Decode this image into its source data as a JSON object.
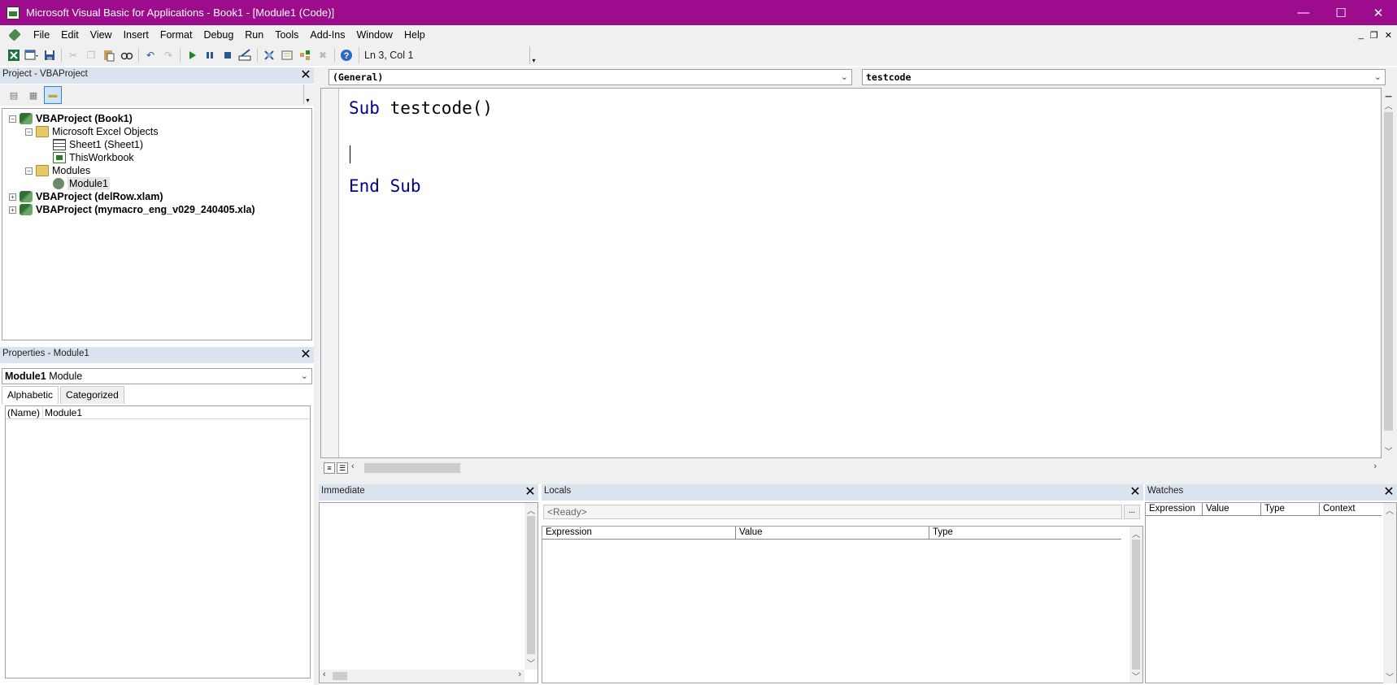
{
  "window": {
    "title": "Microsoft Visual Basic for Applications - Book1 - [Module1 (Code)]",
    "minimize": "—",
    "maximize": "☐",
    "close": "✕"
  },
  "menu": [
    "File",
    "Edit",
    "View",
    "Insert",
    "Format",
    "Debug",
    "Run",
    "Tools",
    "Add-Ins",
    "Window",
    "Help"
  ],
  "mdi": {
    "minimize": "_",
    "restore": "❐",
    "close": "✕"
  },
  "toolbar": {
    "status": "Ln 3, Col 1",
    "icons": [
      "excel-icon",
      "insert-userform-icon",
      "save-icon",
      "cut-icon",
      "copy-icon",
      "paste-icon",
      "find-icon",
      "undo-icon",
      "redo-icon",
      "run-icon",
      "break-icon",
      "reset-icon",
      "design-mode-icon",
      "project-explorer-icon",
      "properties-window-icon",
      "object-browser-icon",
      "toolbox-icon",
      "help-icon"
    ]
  },
  "project": {
    "title": "Project - VBAProject",
    "close": "✕",
    "nodes": [
      {
        "label": "VBAProject (Book1)",
        "bold": true
      },
      {
        "label": "Microsoft Excel Objects",
        "bold": false
      },
      {
        "label": "Sheet1 (Sheet1)",
        "bold": false
      },
      {
        "label": "ThisWorkbook",
        "bold": false
      },
      {
        "label": "Modules",
        "bold": false
      },
      {
        "label": "Module1",
        "bold": false
      },
      {
        "label": "VBAProject (delRow.xlam)",
        "bold": true
      },
      {
        "label": "VBAProject (mymacro_eng_v029_240405.xla)",
        "bold": true
      }
    ]
  },
  "properties": {
    "title": "Properties - Module1",
    "close": "✕",
    "object_name": "Module1",
    "object_type": "Module",
    "tabs": [
      "Alphabetic",
      "Categorized"
    ],
    "rows": [
      {
        "key": "(Name)",
        "value": "Module1"
      }
    ]
  },
  "code": {
    "object_combo": "(General)",
    "procedure_combo": "testcode",
    "lines": [
      {
        "kw": "Sub",
        "rest": " testcode()"
      },
      {
        "kw": "",
        "rest": ""
      },
      {
        "kw": "End Sub",
        "rest": ""
      }
    ]
  },
  "immediate": {
    "title": "Immediate",
    "close": "✕"
  },
  "locals": {
    "title": "Locals",
    "close": "✕",
    "ready": "<Ready>",
    "ellipsis": "...",
    "columns": [
      "Expression",
      "Value",
      "Type"
    ]
  },
  "watches": {
    "title": "Watches",
    "close": "✕",
    "columns": [
      "Expression",
      "Value",
      "Type",
      "Context"
    ]
  },
  "colors": {
    "titlebar": "#9c0c8c",
    "keyword": "#00008b",
    "pane_header": "#dbe4ee"
  }
}
